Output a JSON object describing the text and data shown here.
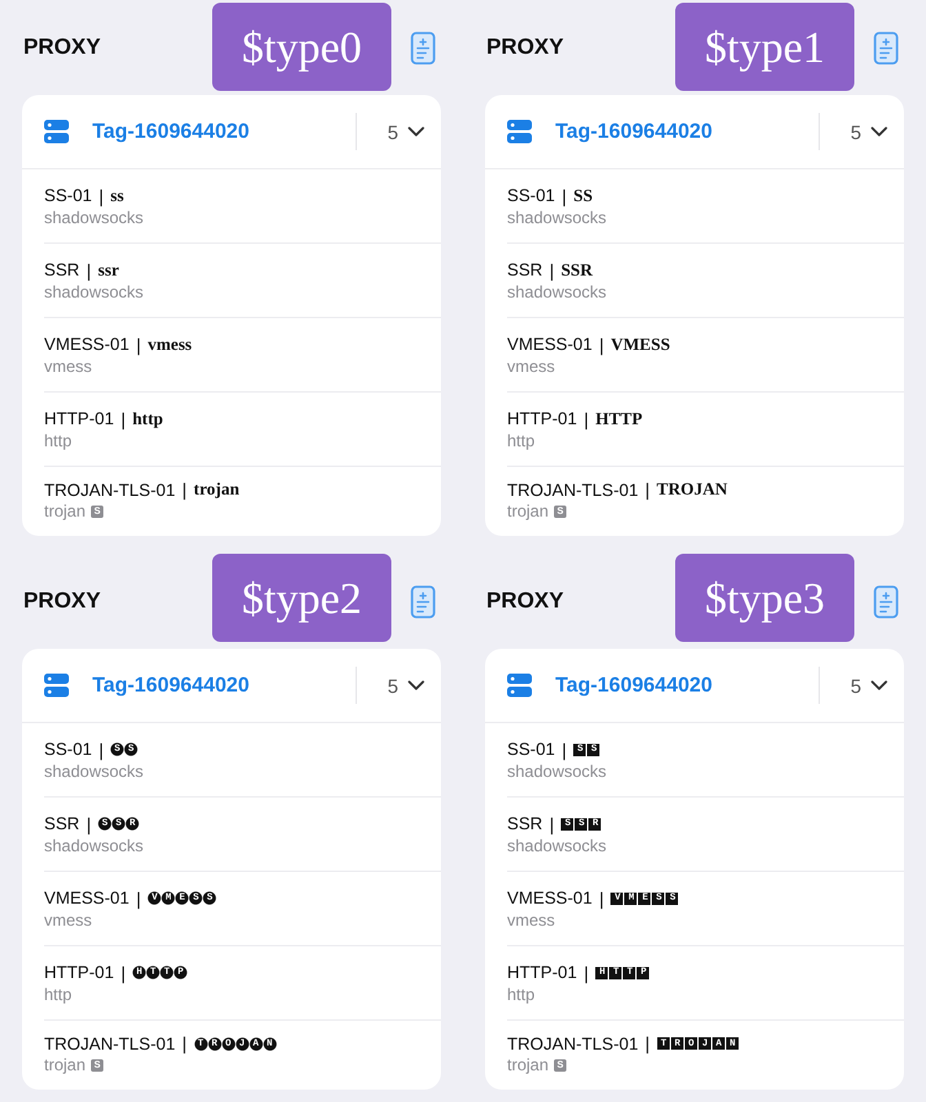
{
  "panels": [
    {
      "heading": "PROXY",
      "annotation": "$type0",
      "kind": "serif",
      "group": {
        "tag": "Tag-1609644020",
        "count": "5"
      },
      "proxies": [
        {
          "name": "SS-01",
          "separator": "|",
          "protocol": "ss",
          "subtitle": "shadowsocks"
        },
        {
          "name": "SSR",
          "separator": "|",
          "protocol": "ssr",
          "subtitle": "shadowsocks"
        },
        {
          "name": "VMESS-01",
          "separator": "|",
          "protocol": "vmess",
          "subtitle": "vmess"
        },
        {
          "name": "HTTP-01",
          "separator": "|",
          "protocol": "http",
          "subtitle": "http"
        },
        {
          "name": "TROJAN-TLS-01",
          "separator": "|",
          "protocol": "trojan",
          "subtitle": "trojan",
          "badge": "S"
        }
      ]
    },
    {
      "heading": "PROXY",
      "annotation": "$type1",
      "kind": "serif",
      "group": {
        "tag": "Tag-1609644020",
        "count": "5"
      },
      "proxies": [
        {
          "name": "SS-01",
          "separator": "|",
          "protocol": "SS",
          "subtitle": "shadowsocks"
        },
        {
          "name": "SSR",
          "separator": "|",
          "protocol": "SSR",
          "subtitle": "shadowsocks"
        },
        {
          "name": "VMESS-01",
          "separator": "|",
          "protocol": "VMESS",
          "subtitle": "vmess"
        },
        {
          "name": "HTTP-01",
          "separator": "|",
          "protocol": "HTTP",
          "subtitle": "http"
        },
        {
          "name": "TROJAN-TLS-01",
          "separator": "|",
          "protocol": "TROJAN",
          "subtitle": "trojan",
          "badge": "S"
        }
      ]
    },
    {
      "heading": "PROXY",
      "annotation": "$type2",
      "kind": "circled",
      "group": {
        "tag": "Tag-1609644020",
        "count": "5"
      },
      "proxies": [
        {
          "name": "SS-01",
          "separator": "|",
          "protocol": "SS",
          "subtitle": "shadowsocks"
        },
        {
          "name": "SSR",
          "separator": "|",
          "protocol": "SSR",
          "subtitle": "shadowsocks"
        },
        {
          "name": "VMESS-01",
          "separator": "|",
          "protocol": "VMESS",
          "subtitle": "vmess"
        },
        {
          "name": "HTTP-01",
          "separator": "|",
          "protocol": "HTTP",
          "subtitle": "http"
        },
        {
          "name": "TROJAN-TLS-01",
          "separator": "|",
          "protocol": "TROJAN",
          "subtitle": "trojan",
          "badge": "S"
        }
      ]
    },
    {
      "heading": "PROXY",
      "annotation": "$type3",
      "kind": "squared",
      "group": {
        "tag": "Tag-1609644020",
        "count": "5"
      },
      "proxies": [
        {
          "name": "SS-01",
          "separator": "|",
          "protocol": "SS",
          "subtitle": "shadowsocks"
        },
        {
          "name": "SSR",
          "separator": "|",
          "protocol": "SSR",
          "subtitle": "shadowsocks"
        },
        {
          "name": "VMESS-01",
          "separator": "|",
          "protocol": "VMESS",
          "subtitle": "vmess"
        },
        {
          "name": "HTTP-01",
          "separator": "|",
          "protocol": "HTTP",
          "subtitle": "http"
        },
        {
          "name": "TROJAN-TLS-01",
          "separator": "|",
          "protocol": "TROJAN",
          "subtitle": "trojan",
          "badge": "S"
        }
      ]
    }
  ]
}
